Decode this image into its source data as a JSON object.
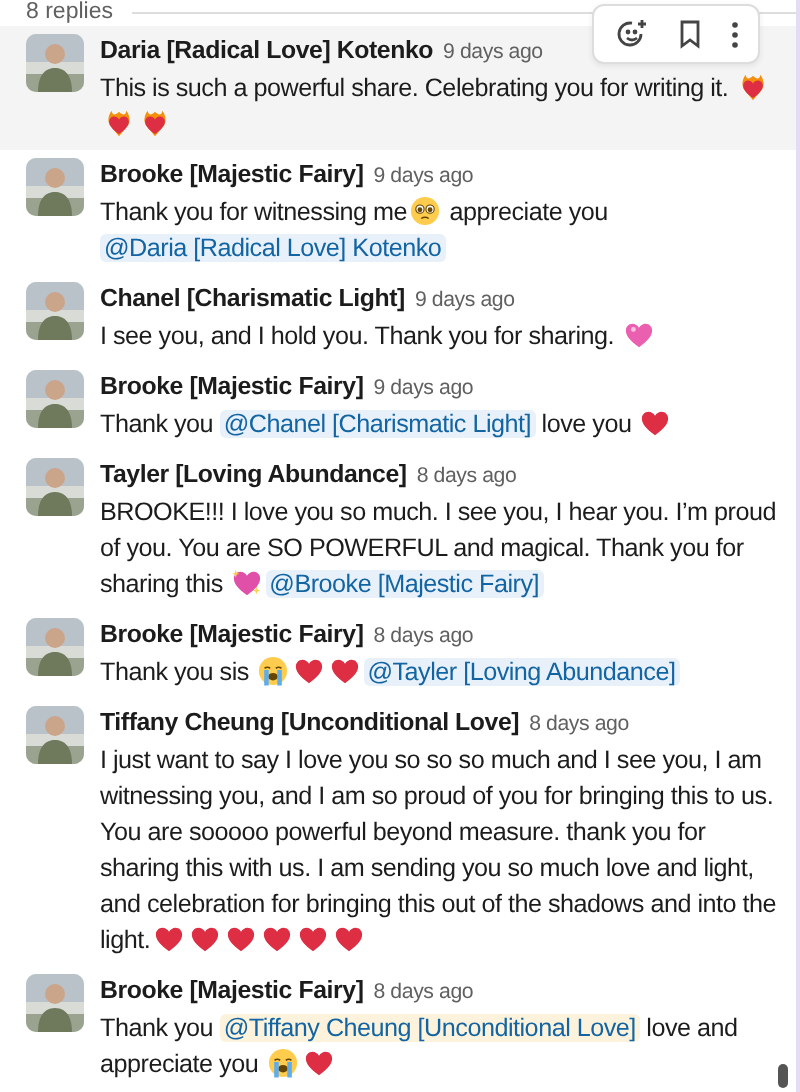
{
  "thread_header": {
    "reply_count": "8 replies"
  },
  "hover_toolbar": {
    "visible": true
  },
  "messages": [
    {
      "author": "Daria [Radical Love] Kotenko",
      "time": "9 days ago",
      "hovered": true,
      "parts": [
        {
          "kind": "text",
          "text": "This is such a powerful share. Celebrating you for writing it. "
        },
        {
          "kind": "fire-heart"
        },
        {
          "kind": "fire-heart"
        },
        {
          "kind": "fire-heart"
        }
      ]
    },
    {
      "author": "Brooke [Majestic Fairy]",
      "time": "9 days ago",
      "parts": [
        {
          "kind": "text",
          "text": "Thank you for witnessing me"
        },
        {
          "kind": "pleading-face"
        },
        {
          "kind": "text",
          "text": " appreciate you "
        },
        {
          "kind": "mention",
          "text": "@Daria [Radical Love] Kotenko",
          "highlighted": false
        }
      ]
    },
    {
      "author": "Chanel [Charismatic Light]",
      "time": "9 days ago",
      "parts": [
        {
          "kind": "text",
          "text": "I see you, and I hold you. Thank you for sharing. "
        },
        {
          "kind": "pink-heart"
        }
      ]
    },
    {
      "author": "Brooke [Majestic Fairy]",
      "time": "9 days ago",
      "parts": [
        {
          "kind": "text",
          "text": "Thank you "
        },
        {
          "kind": "mention",
          "text": "@Chanel [Charismatic Light]",
          "highlighted": false
        },
        {
          "kind": "text",
          "text": " love you "
        },
        {
          "kind": "heart"
        }
      ]
    },
    {
      "author": "Tayler [Loving Abundance]",
      "time": "8 days ago",
      "parts": [
        {
          "kind": "text",
          "text": "BROOKE!!! I love you so much. I see you, I hear you. I’m proud of you. You are SO POWERFUL and magical. Thank you for sharing this "
        },
        {
          "kind": "sparkle-heart"
        },
        {
          "kind": "mention",
          "text": "@Brooke [Majestic Fairy]",
          "highlighted": false
        }
      ]
    },
    {
      "author": "Brooke [Majestic Fairy]",
      "time": "8 days ago",
      "parts": [
        {
          "kind": "text",
          "text": "Thank you sis "
        },
        {
          "kind": "crying-face"
        },
        {
          "kind": "heart"
        },
        {
          "kind": "heart"
        },
        {
          "kind": "mention",
          "text": "@Tayler [Loving Abundance]",
          "highlighted": false
        }
      ]
    },
    {
      "author": "Tiffany Cheung [Unconditional Love]",
      "time": "8 days ago",
      "parts": [
        {
          "kind": "text",
          "text": "I just want to say I love you so so so much and I see you, I am witnessing you, and I am so proud of you for bringing this to us. You are sooooo powerful beyond measure. thank you for sharing this with us. I am sending you so much love and light, and celebration for bringing this out of the shadows and into the light."
        },
        {
          "kind": "heart"
        },
        {
          "kind": "heart"
        },
        {
          "kind": "heart"
        },
        {
          "kind": "heart"
        },
        {
          "kind": "heart"
        },
        {
          "kind": "heart"
        }
      ]
    },
    {
      "author": "Brooke [Majestic Fairy]",
      "time": "8 days ago",
      "parts": [
        {
          "kind": "text",
          "text": "Thank you "
        },
        {
          "kind": "mention",
          "text": "@Tiffany Cheung [Unconditional Love]",
          "highlighted": true
        },
        {
          "kind": "text",
          "text": " love and appreciate you "
        },
        {
          "kind": "crying-face"
        },
        {
          "kind": "heart"
        }
      ]
    }
  ]
}
